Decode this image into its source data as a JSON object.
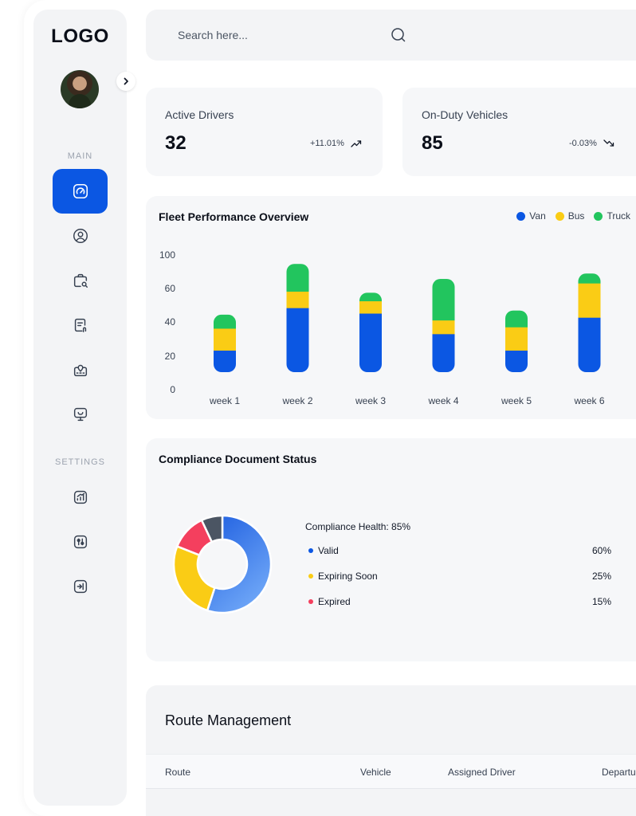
{
  "sidebar": {
    "logo": "LOGO",
    "main_label": "MAIN",
    "settings_label": "SETTINGS"
  },
  "search": {
    "placeholder": "Search here..."
  },
  "stats": [
    {
      "title": "Active Drivers",
      "value": "32",
      "change": "+11.01%",
      "trend": "up"
    },
    {
      "title": "On-Duty Vehicles",
      "value": "85",
      "change": "-0.03%",
      "trend": "down"
    }
  ],
  "colors": {
    "van": "#0b57e3",
    "bus": "#facc15",
    "truck": "#22c55e",
    "expired": "#f43f5e",
    "other": "#4b5563",
    "accent": "#0b57e3"
  },
  "chart_data": {
    "type": "bar",
    "stacked": true,
    "title": "Fleet Performance Overview",
    "categories": [
      "week 1",
      "week 2",
      "week 3",
      "week 4",
      "week 5",
      "week 6"
    ],
    "series": [
      {
        "name": "Van",
        "values": [
          16,
          47,
          43,
          28,
          16,
          40
        ]
      },
      {
        "name": "Bus",
        "values": [
          16,
          12,
          9,
          10,
          17,
          25
        ]
      },
      {
        "name": "Truck",
        "values": [
          10,
          20,
          6,
          30,
          12,
          7
        ]
      }
    ],
    "yticks": [
      0,
      20,
      40,
      60,
      100
    ],
    "ylim": [
      0,
      100
    ],
    "legend": "top-right"
  },
  "compliance": {
    "title": "Compliance Document Status",
    "health": "Compliance Health: 85%",
    "items": [
      {
        "label": "Valid",
        "pct": "60%",
        "value": 60
      },
      {
        "label": "Expiring Soon",
        "pct": "25%",
        "value": 25
      },
      {
        "label": "Expired",
        "pct": "15%",
        "value": 15
      }
    ]
  },
  "route": {
    "title": "Route Management",
    "columns": [
      "Route",
      "Vehicle",
      "Assigned Driver",
      "Departu"
    ]
  }
}
